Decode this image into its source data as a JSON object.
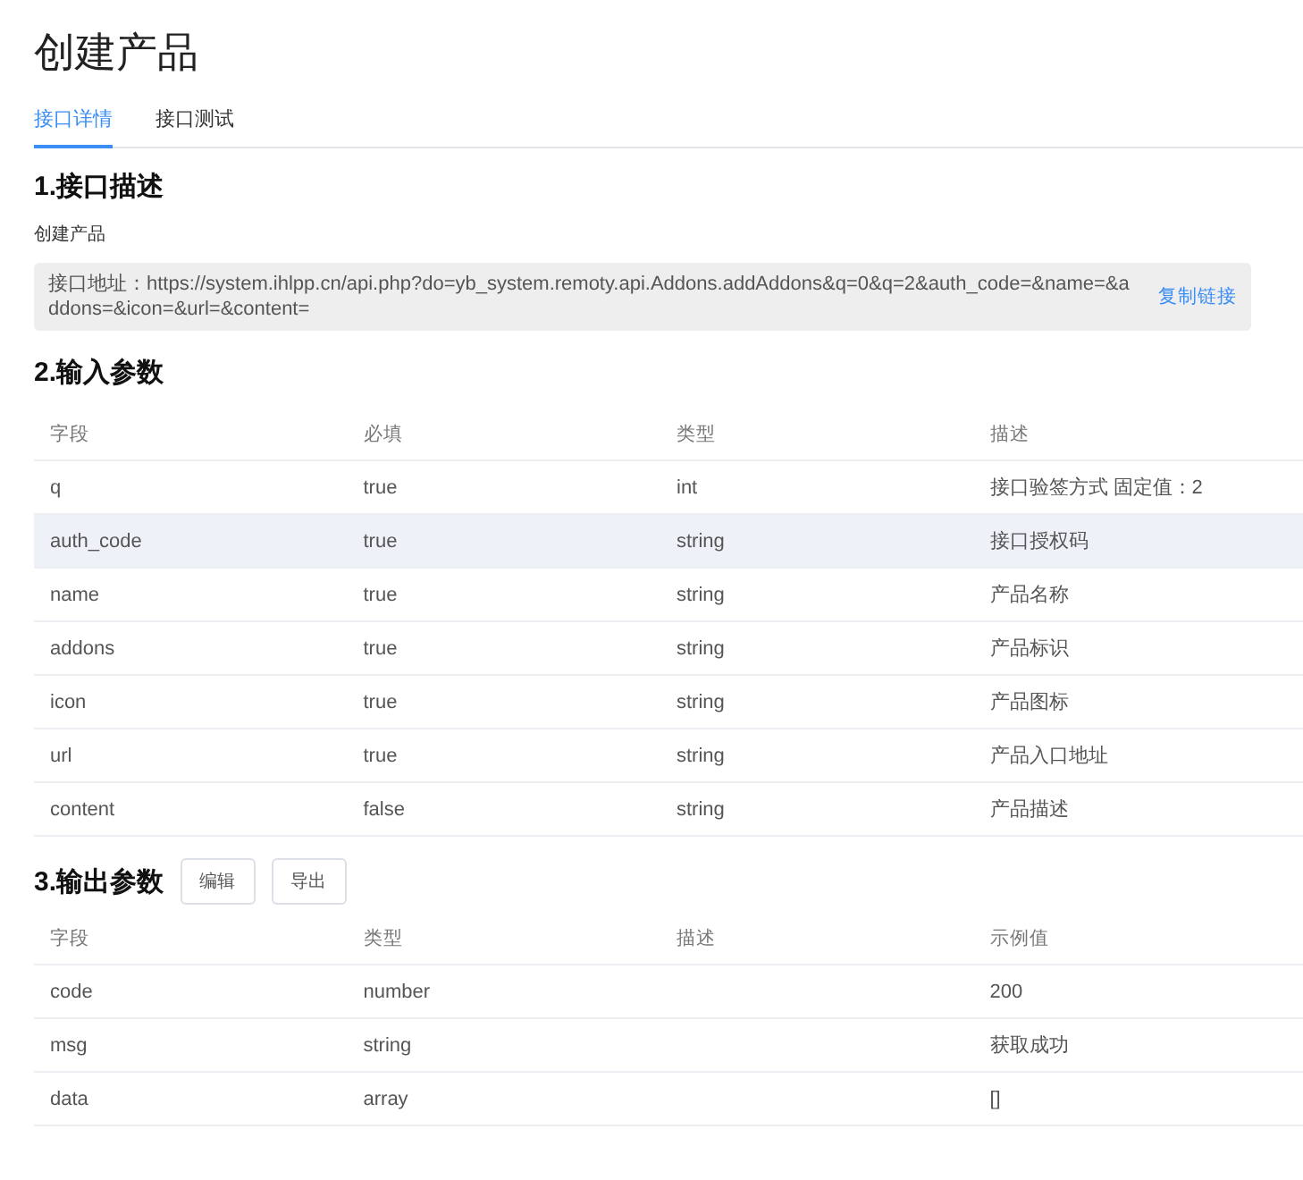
{
  "title": "创建产品",
  "tabs": [
    {
      "label": "接口详情",
      "selected": true
    },
    {
      "label": "接口测试",
      "selected": false
    }
  ],
  "section_1": {
    "heading": "1.接口描述",
    "description": "创建产品",
    "url_box": {
      "text": "接口地址：https://system.ihlpp.cn/api.php?do=yb_system.remoty.api.Addons.addAddons&q=0&q=2&auth_code=&name=&addons=&icon=&url=&content=",
      "copy_link": "复制链接"
    }
  },
  "section_2": {
    "heading": "2.输入参数",
    "table": {
      "columns": [
        "字段",
        "必填",
        "类型",
        "描述"
      ],
      "rows": [
        {
          "cells": [
            "q",
            "true",
            "int",
            "接口验签方式 固定值：2"
          ],
          "highlighted": false
        },
        {
          "cells": [
            "auth_code",
            "true",
            "string",
            "接口授权码"
          ],
          "highlighted": true
        },
        {
          "cells": [
            "name",
            "true",
            "string",
            "产品名称"
          ],
          "highlighted": false
        },
        {
          "cells": [
            "addons",
            "true",
            "string",
            "产品标识"
          ],
          "highlighted": false
        },
        {
          "cells": [
            "icon",
            "true",
            "string",
            "产品图标"
          ],
          "highlighted": false
        },
        {
          "cells": [
            "url",
            "true",
            "string",
            "产品入口地址"
          ],
          "highlighted": false
        },
        {
          "cells": [
            "content",
            "false",
            "string",
            "产品描述"
          ],
          "highlighted": false
        }
      ]
    }
  },
  "section_3": {
    "heading": "3.输出参数",
    "buttons": [
      "编辑",
      "导出"
    ],
    "table": {
      "columns": [
        "字段",
        "类型",
        "描述",
        "示例值"
      ],
      "rows": [
        {
          "cells": [
            "code",
            "number",
            "",
            "200"
          ],
          "highlighted": false
        },
        {
          "cells": [
            "msg",
            "string",
            "",
            "获取成功"
          ],
          "highlighted": false
        },
        {
          "cells": [
            "data",
            "array",
            "",
            "[]"
          ],
          "highlighted": false
        }
      ]
    }
  }
}
